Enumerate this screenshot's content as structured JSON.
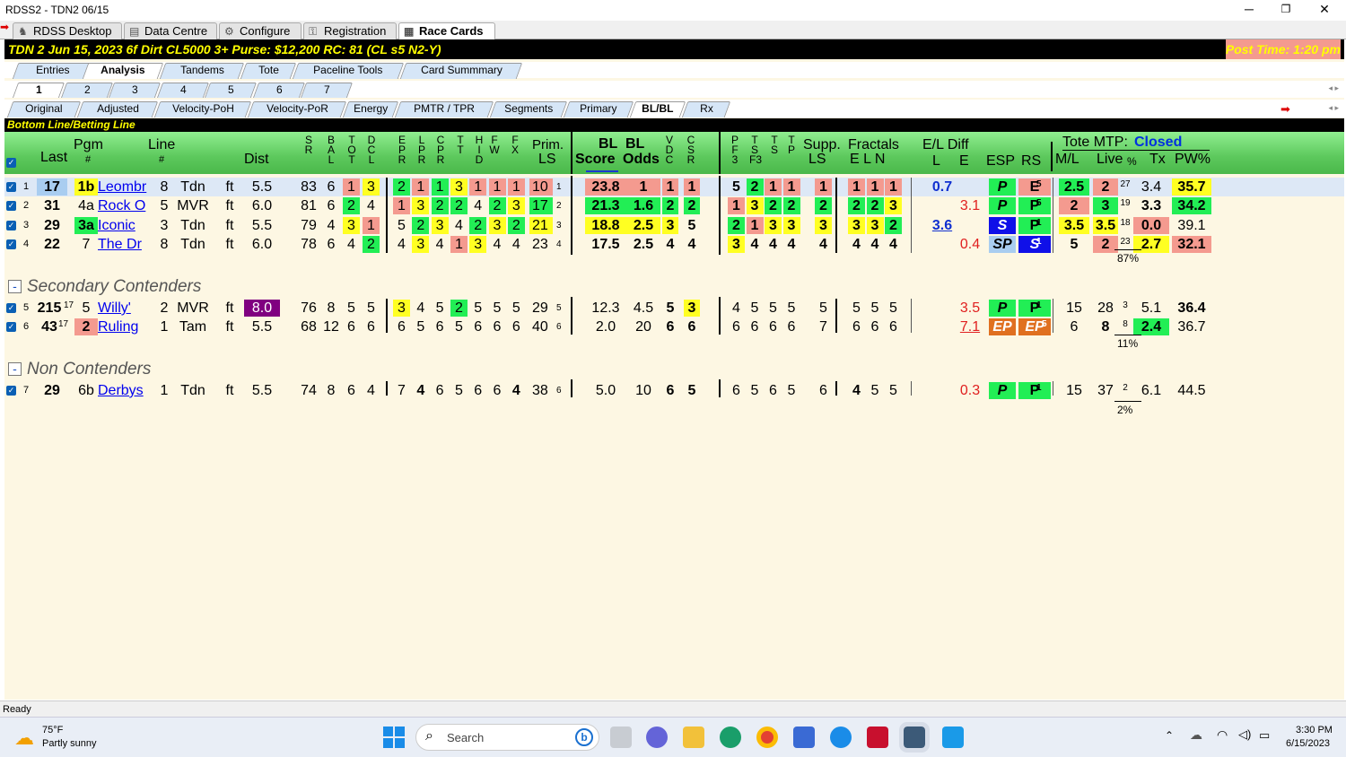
{
  "window": {
    "title": "RDSS2 - TDN2  06/15",
    "minimize": "─",
    "maximize": "❐",
    "close": "✕"
  },
  "nav_tabs": [
    "RDSS Desktop",
    "Data Centre",
    "Configure",
    "Registration",
    "Race Cards"
  ],
  "race_header": {
    "left": "TDN  2   Jun 15, 2023         6f  Dirt   CL5000  3+   Purse: $12,200   RC: 81  (CL s5 N2-Y)",
    "right": "Post Time: 1:20 pm"
  },
  "section_tabs": [
    "Entries",
    "Analysis",
    "Tandems",
    "Tote",
    "Paceline Tools",
    "Card Summmary"
  ],
  "race_tabs": [
    "1",
    "2",
    "3",
    "4",
    "5",
    "6",
    "7"
  ],
  "view_tabs": [
    "Original",
    "Adjusted",
    "Velocity-PoH",
    "Velocity-PoR",
    "Energy",
    "PMTR / TPR",
    "Segments",
    "Primary",
    "BL/BL",
    "Rx"
  ],
  "bottom_line_label": "Bottom Line/Betting Line",
  "headers": {
    "pgm": "Pgm",
    "last": "Last",
    "hash": "#",
    "line": "Line",
    "dist": "Dist",
    "prim": "Prim.",
    "ls": "LS",
    "bl": "BL",
    "bl2": "BL",
    "score": "Score",
    "odds": "Odds",
    "supp": "Supp.",
    "fractals": "Fractals",
    "eln": "E L N",
    "el_diff": "E/L Diff",
    "l": "L",
    "e": "E",
    "esp": "ESP",
    "rs": "RS",
    "tote_mtp": "Tote MTP:",
    "tote_status": "Closed",
    "ml": "M/L",
    "live": "Live",
    "pct": "%",
    "tx": "Tx",
    "pw": "PW%",
    "sr": [
      "S",
      "R"
    ],
    "bal": [
      "B",
      "A",
      "L"
    ],
    "tot": [
      "T",
      "O",
      "T"
    ],
    "dcl": [
      "D",
      "C",
      "L"
    ],
    "epr": [
      "E",
      "P",
      "R"
    ],
    "lpr": [
      "L",
      "P",
      "R"
    ],
    "cpr": [
      "C",
      "P",
      "R"
    ],
    "tt": [
      "T",
      "T"
    ],
    "hid": [
      "H",
      "I",
      "D"
    ],
    "fw": [
      "F",
      "W"
    ],
    "fx": [
      "F",
      "X"
    ],
    "vdc": [
      "V",
      "D",
      "C"
    ],
    "csr": [
      "C",
      "S",
      "R"
    ],
    "pf3": [
      "P",
      "F",
      "3"
    ],
    "tsf3": [
      "T",
      "S",
      "F3"
    ],
    "ts": [
      "T",
      "S"
    ],
    "tp": [
      "T",
      "P"
    ]
  },
  "rows": [
    {
      "n": "1",
      "last": "17",
      "pgm": "1b",
      "name": "Leombr",
      "line": "8",
      "trk": "Tdn",
      "surf": "ft",
      "dist": "5.5",
      "sr": "83",
      "bal": "6",
      "tot": "1",
      "dcl": "3",
      "f": [
        "2",
        "1",
        "1",
        "3",
        "1",
        "1",
        "1"
      ],
      "prim": "10",
      "prim_sup": "1",
      "score": "23.8",
      "odds": "1",
      "vdc": "1",
      "csr": "1",
      "p": [
        "5",
        "2",
        "1",
        "1"
      ],
      "supp": "1",
      "frac": [
        "1",
        "1",
        "1"
      ],
      "el": "0.7",
      "ed": "",
      "esp": "P",
      "rs": "E",
      "rs_sup": "5",
      "ml": "2.5",
      "live": "2",
      "pctsup": "27",
      "tx": "3.4",
      "pw": "35.7",
      "group_pct": ""
    },
    {
      "n": "2",
      "last": "31",
      "pgm": "4a",
      "name": "Rock O",
      "line": "5",
      "trk": "MVR",
      "surf": "ft",
      "dist": "6.0",
      "sr": "81",
      "bal": "6",
      "tot": "2",
      "dcl": "4",
      "f": [
        "1",
        "3",
        "2",
        "2",
        "4",
        "2",
        "3"
      ],
      "prim": "17",
      "prim_sup": "2",
      "score": "21.3",
      "odds": "1.6",
      "vdc": "2",
      "csr": "2",
      "p": [
        "1",
        "3",
        "2",
        "2"
      ],
      "supp": "2",
      "frac": [
        "2",
        "2",
        "3"
      ],
      "el": "",
      "ed": "3.1",
      "esp": "P",
      "rs": "P",
      "rs_sup": "5",
      "ml": "2",
      "live": "3",
      "pctsup": "19",
      "tx": "3.3",
      "pw": "34.2"
    },
    {
      "n": "3",
      "last": "29",
      "pgm": "3a",
      "name": "Iconic",
      "line": "3",
      "trk": "Tdn",
      "surf": "ft",
      "dist": "5.5",
      "sr": "79",
      "bal": "4",
      "tot": "3",
      "dcl": "1",
      "f": [
        "5",
        "2",
        "3",
        "4",
        "2",
        "3",
        "2"
      ],
      "prim": "21",
      "prim_sup": "3",
      "score": "18.8",
      "odds": "2.5",
      "vdc": "3",
      "csr": "5",
      "p": [
        "2",
        "1",
        "3",
        "3"
      ],
      "supp": "3",
      "frac": [
        "3",
        "3",
        "2"
      ],
      "el": "3.6",
      "ed": "",
      "esp": "S",
      "rs": "P",
      "rs_sup": "1",
      "ml": "3.5",
      "live": "3.5",
      "pctsup": "18",
      "tx": "0.0",
      "pw": "39.1"
    },
    {
      "n": "4",
      "last": "22",
      "pgm": "7",
      "name": "The Dr",
      "line": "8",
      "trk": "Tdn",
      "surf": "ft",
      "dist": "6.0",
      "sr": "78",
      "bal": "6",
      "tot": "4",
      "dcl": "2",
      "f": [
        "4",
        "3",
        "4",
        "1",
        "3",
        "4",
        "4"
      ],
      "prim": "23",
      "prim_sup": "4",
      "score": "17.5",
      "odds": "2.5",
      "vdc": "4",
      "csr": "4",
      "p": [
        "3",
        "4",
        "4",
        "4"
      ],
      "supp": "4",
      "frac": [
        "4",
        "4",
        "4"
      ],
      "el": "",
      "ed": "0.4",
      "esp": "SP",
      "rs": "S",
      "rs_sup": "1",
      "ml": "5",
      "live": "2",
      "pctsup": "23",
      "tx": "2.7",
      "pw": "32.1"
    },
    {
      "n": "5",
      "last": "215",
      "last_sup": "17",
      "pgm": "5",
      "name": "Willy'",
      "line": "2",
      "trk": "MVR",
      "surf": "ft",
      "dist": "8.0",
      "sr": "76",
      "bal": "8",
      "tot": "5",
      "dcl": "5",
      "f": [
        "3",
        "4",
        "5",
        "2",
        "5",
        "5",
        "5"
      ],
      "prim": "29",
      "prim_sup": "5",
      "score": "12.3",
      "odds": "4.5",
      "vdc": "5",
      "csr": "3",
      "p": [
        "4",
        "5",
        "5",
        "5"
      ],
      "supp": "5",
      "frac": [
        "5",
        "5",
        "5"
      ],
      "el": "",
      "ed": "3.5",
      "esp": "P",
      "rs": "P",
      "rs_sup": "1",
      "ml": "15",
      "live": "28",
      "pctsup": "3",
      "tx": "5.1",
      "pw": "36.4"
    },
    {
      "n": "6",
      "last": "43",
      "last_sup": "17",
      "pgm": "2",
      "name": "Ruling",
      "line": "1",
      "trk": "Tam",
      "surf": "ft",
      "dist": "5.5",
      "sr": "68",
      "bal": "12",
      "tot": "6",
      "dcl": "6",
      "f": [
        "6",
        "5",
        "6",
        "5",
        "6",
        "6",
        "6"
      ],
      "prim": "40",
      "prim_sup": "6",
      "score": "2.0",
      "odds": "20",
      "vdc": "6",
      "csr": "6",
      "p": [
        "6",
        "6",
        "6",
        "6"
      ],
      "supp": "7",
      "frac": [
        "6",
        "6",
        "6"
      ],
      "el": "",
      "ed": "7.1",
      "esp": "EP",
      "rs": "EP",
      "rs_sup": "5",
      "ml": "6",
      "live": "8",
      "pctsup": "8",
      "tx": "2.4",
      "pw": "36.7"
    },
    {
      "n": "7",
      "last": "29",
      "pgm": "6b",
      "name": "Derbys",
      "line": "1",
      "trk": "Tdn",
      "surf": "ft",
      "dist": "5.5",
      "sr": "74",
      "bal": "8",
      "tot": "6",
      "dcl": "4",
      "f": [
        "7",
        "4",
        "6",
        "5",
        "6",
        "6",
        "4"
      ],
      "prim": "38",
      "prim_sup": "6",
      "score": "5.0",
      "odds": "10",
      "vdc": "6",
      "csr": "5",
      "p": [
        "6",
        "5",
        "6",
        "5"
      ],
      "supp": "6",
      "frac": [
        "4",
        "5",
        "5"
      ],
      "el": "",
      "ed": "0.3",
      "esp": "P",
      "rs": "P",
      "rs_sup": "1",
      "ml": "15",
      "live": "37",
      "pctsup": "2",
      "tx": "6.1",
      "pw": "44.5"
    }
  ],
  "group_totals": [
    "87%",
    "11%",
    "2%"
  ],
  "sections": {
    "secondary": "Secondary Contenders",
    "non": "Non Contenders",
    "collapse": "-"
  },
  "status": "Ready",
  "taskbar": {
    "temp": "75°F",
    "weather": "Partly sunny",
    "search": "Search",
    "time": "3:30 PM",
    "date": "6/15/2023"
  }
}
